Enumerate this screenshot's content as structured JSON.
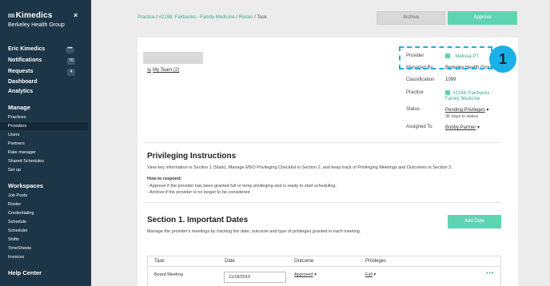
{
  "sidebar": {
    "brand": "Kimedics",
    "brand_mark": "IIII",
    "close": "×",
    "org": "Berkeley Health Group",
    "user": "Eric Kimedics",
    "user_menu": "•••",
    "main_items": [
      {
        "label": "Notifications",
        "badge": "76"
      },
      {
        "label": "Requests",
        "badge": "4"
      },
      {
        "label": "Dashboard",
        "badge": ""
      },
      {
        "label": "Analytics",
        "badge": ""
      }
    ],
    "manage_head": "Manage",
    "manage_items": [
      "Practices",
      "Providers",
      "Users",
      "Partners",
      "Rate manager",
      "Shared Schedules",
      "Set up"
    ],
    "workspaces_head": "Workspaces",
    "workspace_items": [
      "Job Posts",
      "Roster",
      "Credentialing",
      "Schedule",
      "Scheduler",
      "Shifts",
      "TimeSheets",
      "Invoices"
    ],
    "help": "Help Center"
  },
  "breadcrumb": {
    "practice": "Practice",
    "sep": " / ",
    "practice_name": "#2198: Fairbanks - Family Medicine",
    "roster": "Roster",
    "current": "Task"
  },
  "actions": {
    "archive": "Archive",
    "approve": "Approve"
  },
  "profile": {
    "my_team": "My Team (2)",
    "team_icon": "⇆",
    "provider_label": "Provider",
    "provider_value": ", Melissa PT",
    "managed_label": "Managed By",
    "managed_value": "Berkeley Health Group",
    "classification_label": "Classification",
    "classification_value": "1099",
    "practice_label": "Practice",
    "practice_value_1": "#2198: Fairbanks -",
    "practice_value_2": "Family Medicine",
    "status_label": "Status",
    "status_value": "Pending Privileges",
    "status_caret": "▾",
    "status_note": "36 days in status",
    "assigned_label": "Assigned To",
    "assigned_value": "Bobby Partner",
    "assigned_caret": "▾"
  },
  "callout": {
    "step": "1"
  },
  "instructions": {
    "title": "Privileging Instructions",
    "body": "View key information in Section 1 (Stats), Manage MSO Privileging Checklist in Section 2, and keep track of Privileging Meetings and Outcomes in Section 3.",
    "how_head": "How to respond:",
    "how_1": "- Approve if the provider has been granted full or temp privileging and is ready to start scheduling.",
    "how_2": "- Archive if the provider is no longer to be considered"
  },
  "section1": {
    "title": "Section 1. Important Dates",
    "body": "Manage the provider's meetings by tracking the date, outcome and type of privileges granted in each meeting.",
    "add_button": "Add Date",
    "columns": [
      "Task",
      "Date",
      "Outcome",
      "Privileges"
    ],
    "rows": [
      {
        "task": "Board Meeting",
        "date": "11/18/2019",
        "outcome": "Approved",
        "privileges": "Full",
        "caret": "▾",
        "menu": "•••"
      }
    ]
  },
  "colors": {
    "accent": "#5fd4b3",
    "sidebar": "#1c3647",
    "callout": "#1ab0e8"
  }
}
